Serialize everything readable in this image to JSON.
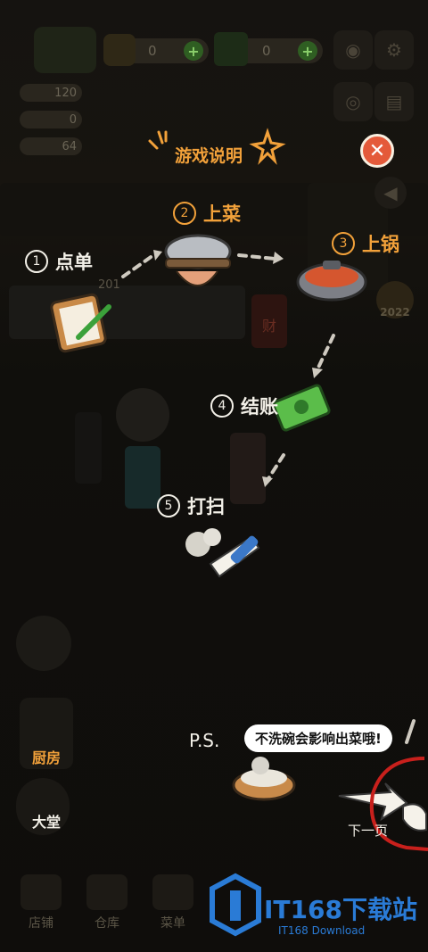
{
  "top_bar": {
    "coin_value": "0",
    "cash_value": "0",
    "stat_1": "120",
    "stat_2": "0",
    "stat_3": "64"
  },
  "tutorial": {
    "title": "游戏说明",
    "steps": [
      {
        "num": "1",
        "label": "点单"
      },
      {
        "num": "2",
        "label": "上菜"
      },
      {
        "num": "3",
        "label": "上锅"
      },
      {
        "num": "4",
        "label": "结账"
      },
      {
        "num": "5",
        "label": "打扫"
      }
    ],
    "ps_label": "P.S.",
    "ps_text": "不洗碗会影响出菜哦!",
    "next_label": "下一页"
  },
  "scene_labels": {
    "table_number": "201",
    "badge_year": "2022",
    "cai_char": "财"
  },
  "side_menu": {
    "kitchen": "厨房",
    "hall": "大堂"
  },
  "bottom_nav": {
    "items": [
      "店铺",
      "仓库",
      "菜单"
    ]
  },
  "watermark": {
    "brand": "IT168下载站",
    "sub": "IT168 Download"
  },
  "colors": {
    "accent_orange": "#f2a13a",
    "close_red": "#e45a3a",
    "annotation_red": "#c8201c",
    "watermark_blue": "#2a7bd6"
  }
}
